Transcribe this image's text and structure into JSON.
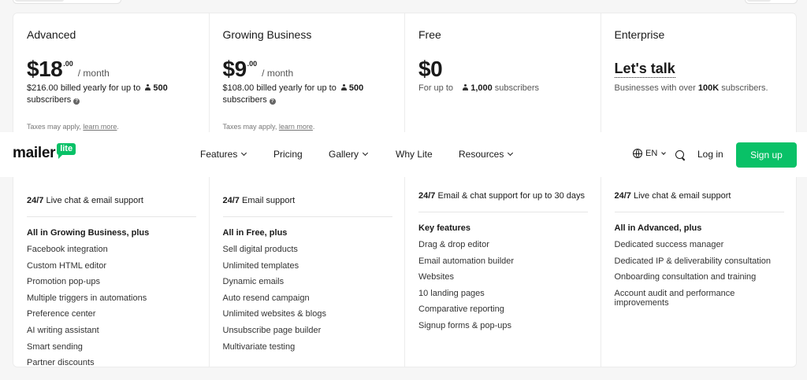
{
  "nav": {
    "logo_text": "mailer",
    "logo_badge": "lite",
    "items": [
      {
        "label": "Features",
        "dropdown": true
      },
      {
        "label": "Pricing",
        "dropdown": false
      },
      {
        "label": "Gallery",
        "dropdown": true
      },
      {
        "label": "Why Lite",
        "dropdown": false
      },
      {
        "label": "Resources",
        "dropdown": true
      }
    ],
    "language": "EN",
    "login": "Log in",
    "signup": "Sign up",
    "accent_color": "#09c167"
  },
  "plans": [
    {
      "name": "Advanced",
      "price": "$18",
      "cents": ".00",
      "per": "/ month",
      "billed_prefix": "$216.00 billed yearly for up to",
      "subscribers": "500",
      "billed_suffix": "subscribers",
      "taxes": "Taxes may apply,",
      "learn_more": "learn more",
      "support_bold": "24/7",
      "support_text": "Live chat & email support",
      "features_heading": "All in Growing Business, plus",
      "features": [
        "Facebook integration",
        "Custom HTML editor",
        "Promotion pop-ups",
        "Multiple triggers in automations",
        "Preference center",
        "AI writing assistant",
        "Smart sending",
        "Partner discounts"
      ]
    },
    {
      "name": "Growing Business",
      "price": "$9",
      "cents": ".00",
      "per": "/ month",
      "billed_prefix": "$108.00 billed yearly for up to",
      "subscribers": "500",
      "billed_suffix": "subscribers",
      "taxes": "Taxes may apply,",
      "learn_more": "learn more",
      "support_bold": "24/7",
      "support_text": "Email support",
      "features_heading": "All in Free, plus",
      "features": [
        "Sell digital products",
        "Unlimited templates",
        "Dynamic emails",
        "Auto resend campaign",
        "Unlimited websites & blogs",
        "Unsubscribe page builder",
        "Multivariate testing"
      ]
    },
    {
      "name": "Free",
      "price": "$0",
      "for_up_to": "For up to",
      "subscribers": "1,000",
      "subscribers_label": "subscribers",
      "support_bold": "24/7",
      "support_text": "Email & chat support for up to 30 days",
      "features_heading": "Key features",
      "features": [
        "Drag & drop editor",
        "Email automation builder",
        "Websites",
        "10 landing pages",
        "Comparative reporting",
        "Signup forms & pop-ups"
      ]
    },
    {
      "name": "Enterprise",
      "cta": "Let's talk",
      "desc_prefix": "Businesses with over",
      "desc_bold": "100K",
      "desc_suffix": "subscribers.",
      "support_bold": "24/7",
      "support_text": "Live chat & email support",
      "features_heading": "All in Advanced, plus",
      "features": [
        "Dedicated success manager",
        "Dedicated IP & deliverability consultation",
        "Onboarding consultation and training",
        "Account audit and performance improvements"
      ]
    }
  ]
}
